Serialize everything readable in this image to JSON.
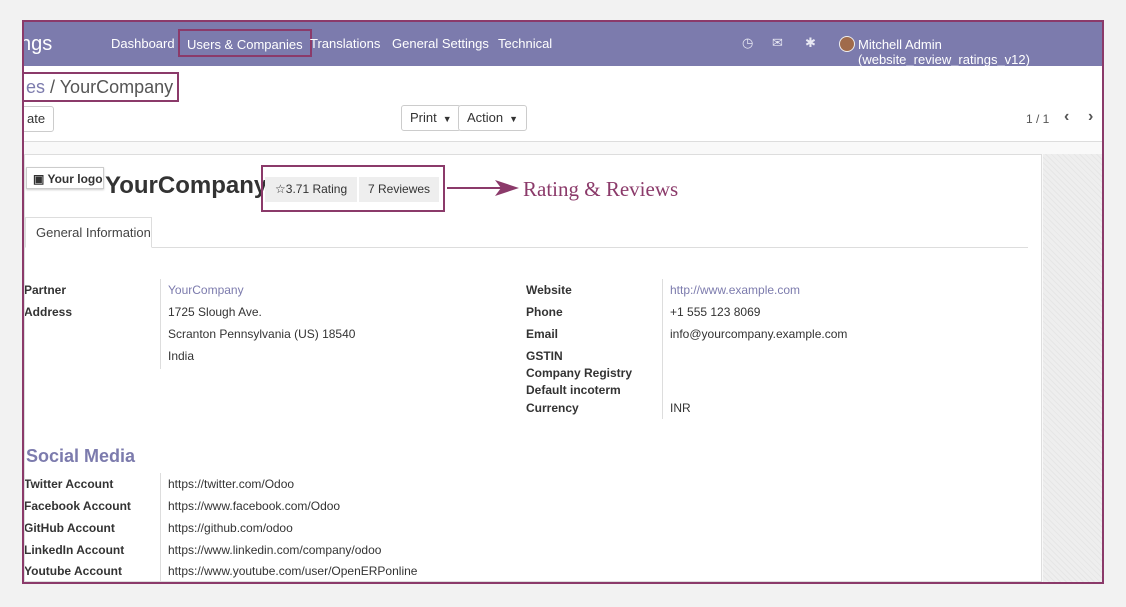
{
  "navbar": {
    "brand": "ngs",
    "menu": [
      "Dashboard",
      "Users & Companies",
      "Translations",
      "General Settings",
      "Technical"
    ],
    "user": "Mitchell Admin (website_review_ratings_v12)"
  },
  "breadcrumb": {
    "parent": "es",
    "separator": " / ",
    "current": "YourCompany"
  },
  "toolbar": {
    "create_label": "ate",
    "print_label": "Print",
    "action_label": "Action",
    "pager": "1 / 1"
  },
  "form": {
    "logo_label": "Your logo",
    "company_name": "YourCompany",
    "rating_label": "3.71 Rating",
    "reviews_label": "7 Reviewes",
    "annotation": "Rating & Reviews",
    "tab_label": "General Information",
    "left_fields": {
      "partner_label": "Partner",
      "partner_value": "YourCompany",
      "address_label": "Address",
      "street": "1725 Slough Ave.",
      "city_line": "Scranton  Pennsylvania (US)  18540",
      "country": "India"
    },
    "right_fields": {
      "website_label": "Website",
      "website_value": "http://www.example.com",
      "phone_label": "Phone",
      "phone_value": "+1 555 123 8069",
      "email_label": "Email",
      "email_value": "info@yourcompany.example.com",
      "gstin_label": "GSTIN",
      "registry_label": "Company Registry",
      "incoterm_label": "Default incoterm",
      "currency_label": "Currency",
      "currency_value": "INR"
    },
    "social_title": "Social Media",
    "social": [
      {
        "label": "Twitter Account",
        "value": "https://twitter.com/Odoo"
      },
      {
        "label": "Facebook Account",
        "value": "https://www.facebook.com/Odoo"
      },
      {
        "label": "GitHub Account",
        "value": "https://github.com/odoo"
      },
      {
        "label": "LinkedIn Account",
        "value": "https://www.linkedin.com/company/odoo"
      },
      {
        "label": "Youtube Account",
        "value": "https://www.youtube.com/user/OpenERPonline"
      }
    ]
  },
  "colors": {
    "navbar": "#7c7bad",
    "highlight": "#8b3a6a",
    "link": "#7c7bad"
  }
}
